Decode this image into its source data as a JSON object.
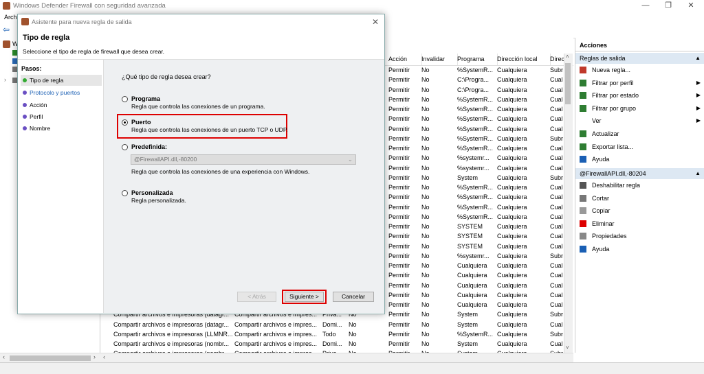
{
  "window": {
    "title": "Windows Defender Firewall con seguridad avanzada",
    "min": "—",
    "max": "❐",
    "close": "✕"
  },
  "menu": {
    "first": "Arch"
  },
  "tree": {
    "first_initial": "W"
  },
  "grid": {
    "columns": [
      "Acción",
      "Invalidar",
      "Programa",
      "Dirección local",
      "Direc"
    ],
    "rows": [
      [
        "Permitir",
        "No",
        "%SystemR...",
        "Cualquiera",
        "Subr"
      ],
      [
        "Permitir",
        "No",
        "C:\\Progra...",
        "Cualquiera",
        "Cual"
      ],
      [
        "Permitir",
        "No",
        "C:\\Progra...",
        "Cualquiera",
        "Cual"
      ],
      [
        "Permitir",
        "No",
        "%SystemR...",
        "Cualquiera",
        "Cual"
      ],
      [
        "Permitir",
        "No",
        "%SystemR...",
        "Cualquiera",
        "Cual"
      ],
      [
        "Permitir",
        "No",
        "%SystemR...",
        "Cualquiera",
        "Cual"
      ],
      [
        "Permitir",
        "No",
        "%SystemR...",
        "Cualquiera",
        "Cual"
      ],
      [
        "Permitir",
        "No",
        "%SystemR...",
        "Cualquiera",
        "Subr"
      ],
      [
        "Permitir",
        "No",
        "%SystemR...",
        "Cualquiera",
        "Cual"
      ],
      [
        "Permitir",
        "No",
        "%systemr...",
        "Cualquiera",
        "Cual"
      ],
      [
        "Permitir",
        "No",
        "%systemr...",
        "Cualquiera",
        "Cual"
      ],
      [
        "Permitir",
        "No",
        "System",
        "Cualquiera",
        "Subr"
      ],
      [
        "Permitir",
        "No",
        "%SystemR...",
        "Cualquiera",
        "Cual"
      ],
      [
        "Permitir",
        "No",
        "%SystemR...",
        "Cualquiera",
        "Cual"
      ],
      [
        "Permitir",
        "No",
        "%SystemR...",
        "Cualquiera",
        "Cual"
      ],
      [
        "Permitir",
        "No",
        "%SystemR...",
        "Cualquiera",
        "Cual"
      ],
      [
        "Permitir",
        "No",
        "SYSTEM",
        "Cualquiera",
        "Cual"
      ],
      [
        "Permitir",
        "No",
        "SYSTEM",
        "Cualquiera",
        "Cual"
      ],
      [
        "Permitir",
        "No",
        "SYSTEM",
        "Cualquiera",
        "Cual"
      ],
      [
        "Permitir",
        "No",
        "%systemr...",
        "Cualquiera",
        "Subr"
      ],
      [
        "Permitir",
        "No",
        "Cualquiera",
        "Cualquiera",
        "Cual"
      ],
      [
        "Permitir",
        "No",
        "Cualquiera",
        "Cualquiera",
        "Cual"
      ],
      [
        "Permitir",
        "No",
        "Cualquiera",
        "Cualquiera",
        "Cual"
      ],
      [
        "Permitir",
        "No",
        "Cualquiera",
        "Cualquiera",
        "Cual"
      ],
      [
        "Permitir",
        "No",
        "Cualquiera",
        "Cualquiera",
        "Cual"
      ]
    ],
    "full_rows": [
      [
        "Compartir archivos e impresoras (datagr...",
        "Compartir archivos e impres...",
        "Priva...",
        "No",
        "Permitir",
        "No",
        "System",
        "Cualquiera",
        "Subr"
      ],
      [
        "Compartir archivos e impresoras (datagr...",
        "Compartir archivos e impres...",
        "Domi...",
        "No",
        "Permitir",
        "No",
        "System",
        "Cualquiera",
        "Cual"
      ],
      [
        "Compartir archivos e impresoras (LLMNR...",
        "Compartir archivos e impres...",
        "Todo",
        "No",
        "Permitir",
        "No",
        "%SystemR...",
        "Cualquiera",
        "Subr"
      ],
      [
        "Compartir archivos e impresoras (nombr...",
        "Compartir archivos e impres...",
        "Domi...",
        "No",
        "Permitir",
        "No",
        "System",
        "Cualquiera",
        "Cual"
      ],
      [
        "Compartir archivos e impresoras (nombr...",
        "Compartir archivos e impres...",
        "Priva...",
        "No",
        "Permitir",
        "No",
        "System",
        "Cualquiera",
        "Subr"
      ]
    ]
  },
  "actions": {
    "title": "Acciones",
    "section1": "Reglas de salida",
    "items1": [
      "Nueva regla...",
      "Filtrar por perfil",
      "Filtrar por estado",
      "Filtrar por grupo",
      "Ver",
      "Actualizar",
      "Exportar lista...",
      "Ayuda"
    ],
    "section2": "@FirewallAPI.dll,-80204",
    "items2": [
      "Deshabilitar regla",
      "Cortar",
      "Copiar",
      "Eliminar",
      "Propiedades",
      "Ayuda"
    ]
  },
  "dialog": {
    "title": "Asistente para nueva regla de salida",
    "heading": "Tipo de regla",
    "subheading": "Seleccione el tipo de regla de firewall que desea crear.",
    "steps_title": "Pasos:",
    "steps": [
      "Tipo de regla",
      "Protocolo y puertos",
      "Acción",
      "Perfil",
      "Nombre"
    ],
    "question": "¿Qué tipo de regla desea crear?",
    "options": [
      {
        "label": "Programa",
        "desc": "Regla que controla las conexiones de un programa."
      },
      {
        "label": "Puerto",
        "desc": "Regla que controla las conexiones de un puerto TCP o UDP."
      },
      {
        "label": "Predefinida:",
        "desc": "Regla que controla las conexiones de una experiencia con Windows."
      },
      {
        "label": "Personalizada",
        "desc": "Regla personalizada."
      }
    ],
    "combo_value": "@FirewallAPI.dll,-80200",
    "buttons": {
      "back": "< Atrás",
      "next": "Siguiente >",
      "cancel": "Cancelar"
    }
  },
  "colors": {
    "highlight": "#d00000",
    "section_bg": "#dde8f3",
    "link": "#1a5fb4"
  }
}
